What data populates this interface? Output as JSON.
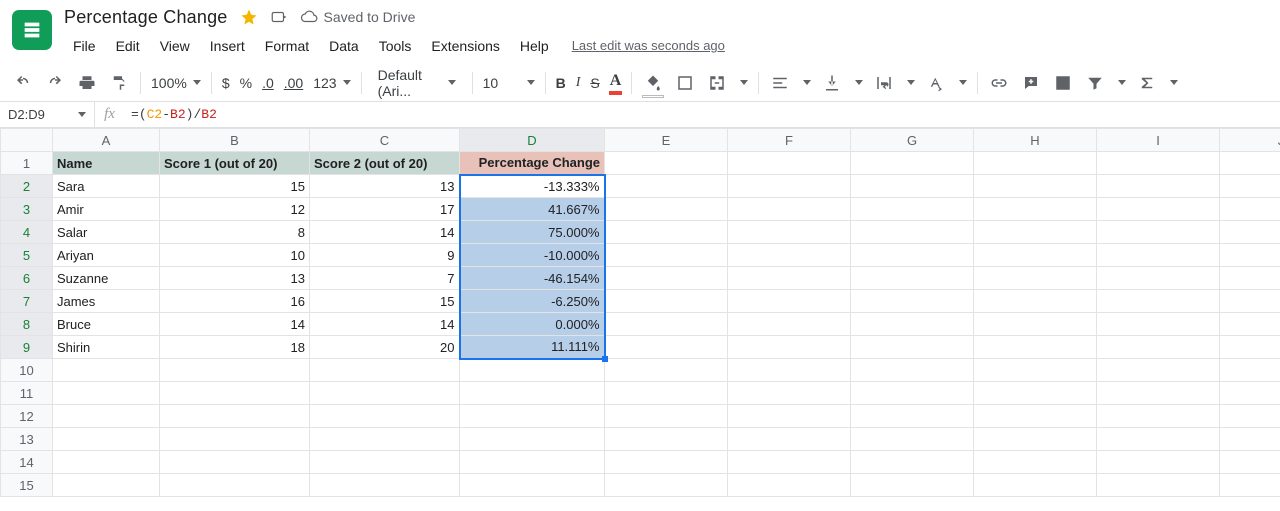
{
  "doc": {
    "title": "Percentage Change",
    "saved": "Saved to Drive",
    "last_edit": "Last edit was seconds ago"
  },
  "menu": {
    "file": "File",
    "edit": "Edit",
    "view": "View",
    "insert": "Insert",
    "format": "Format",
    "data": "Data",
    "tools": "Tools",
    "extensions": "Extensions",
    "help": "Help"
  },
  "toolbar": {
    "zoom": "100%",
    "currency": "$",
    "percent": "%",
    "dec_less": ".0",
    "dec_more": ".00",
    "numfmt": "123",
    "font": "Default (Ari...",
    "size": "10",
    "bold": "B",
    "italic": "I",
    "strike": "S",
    "text_color": "A"
  },
  "namebox": "D2:D9",
  "formula": {
    "eq": "=",
    "lp": "(",
    "ref1": "C2",
    "minus": "-",
    "ref2a": "B2",
    "rp": ")",
    "slash": "/",
    "ref2b": "B2"
  },
  "columns": [
    "A",
    "B",
    "C",
    "D",
    "E",
    "F",
    "G",
    "H",
    "I",
    "J"
  ],
  "row_numbers": [
    "1",
    "2",
    "3",
    "4",
    "5",
    "6",
    "7",
    "8",
    "9",
    "10",
    "11",
    "12",
    "13",
    "14",
    "15"
  ],
  "headers": {
    "A": "Name",
    "B": "Score 1 (out of 20)",
    "C": "Score 2 (out of 20)",
    "D": "Percentage Change"
  },
  "rows": [
    {
      "name": "Sara",
      "s1": "15",
      "s2": "13",
      "pct": "-13.333%"
    },
    {
      "name": "Amir",
      "s1": "12",
      "s2": "17",
      "pct": "41.667%"
    },
    {
      "name": "Salar",
      "s1": "8",
      "s2": "14",
      "pct": "75.000%"
    },
    {
      "name": "Ariyan",
      "s1": "10",
      "s2": "9",
      "pct": "-10.000%"
    },
    {
      "name": "Suzanne",
      "s1": "13",
      "s2": "7",
      "pct": "-46.154%"
    },
    {
      "name": "James",
      "s1": "16",
      "s2": "15",
      "pct": "-6.250%"
    },
    {
      "name": "Bruce",
      "s1": "14",
      "s2": "14",
      "pct": "0.000%"
    },
    {
      "name": "Shirin",
      "s1": "18",
      "s2": "20",
      "pct": "11.111%"
    }
  ]
}
